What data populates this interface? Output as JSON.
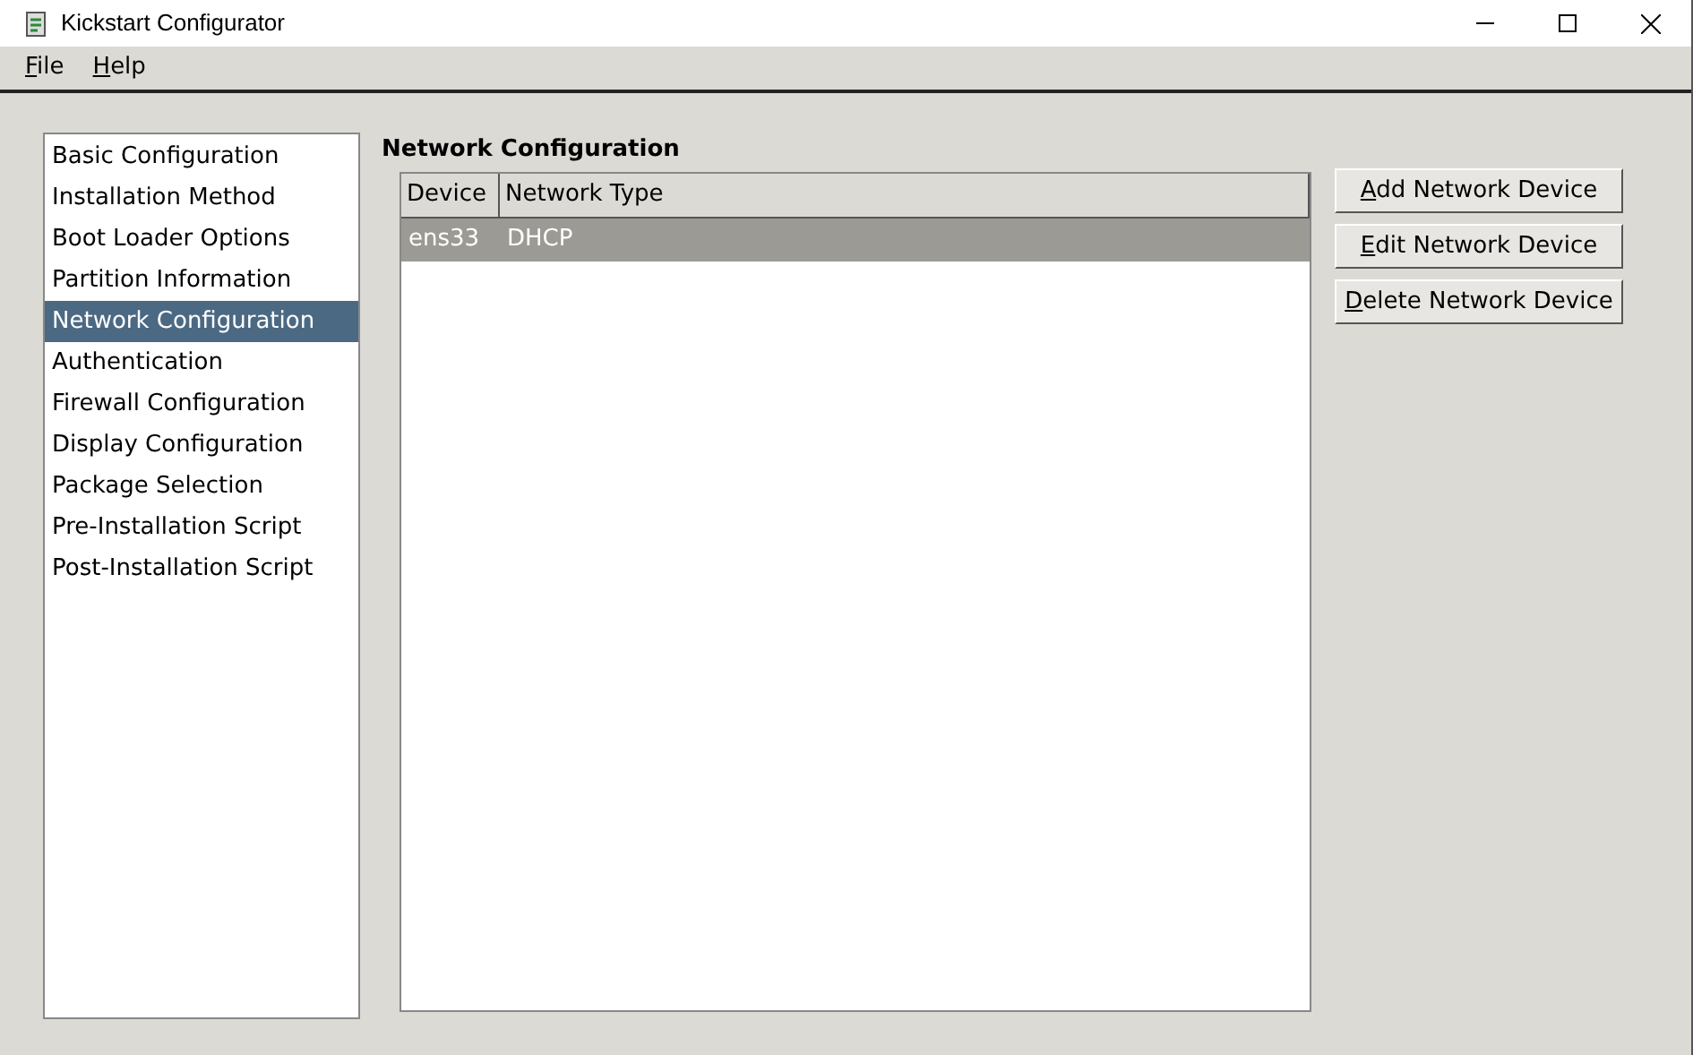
{
  "window": {
    "title": "Kickstart Configurator"
  },
  "menu": [
    {
      "label": "File"
    },
    {
      "label": "Help"
    }
  ],
  "sidebar": {
    "items": [
      {
        "label": "Basic Configuration",
        "selected": false
      },
      {
        "label": "Installation Method",
        "selected": false
      },
      {
        "label": "Boot Loader Options",
        "selected": false
      },
      {
        "label": "Partition Information",
        "selected": false
      },
      {
        "label": "Network Configuration",
        "selected": true
      },
      {
        "label": "Authentication",
        "selected": false
      },
      {
        "label": "Firewall Configuration",
        "selected": false
      },
      {
        "label": "Display Configuration",
        "selected": false
      },
      {
        "label": "Package Selection",
        "selected": false
      },
      {
        "label": "Pre-Installation Script",
        "selected": false
      },
      {
        "label": "Post-Installation Script",
        "selected": false
      }
    ]
  },
  "section_title": "Network Configuration",
  "table": {
    "columns": [
      "Device",
      "Network Type"
    ],
    "rows": [
      {
        "cells": [
          "ens33",
          "DHCP"
        ],
        "selected": true
      }
    ]
  },
  "buttons": [
    {
      "label": "Add Network Device"
    },
    {
      "label": "Edit Network Device"
    },
    {
      "label": "Delete Network Device"
    }
  ]
}
